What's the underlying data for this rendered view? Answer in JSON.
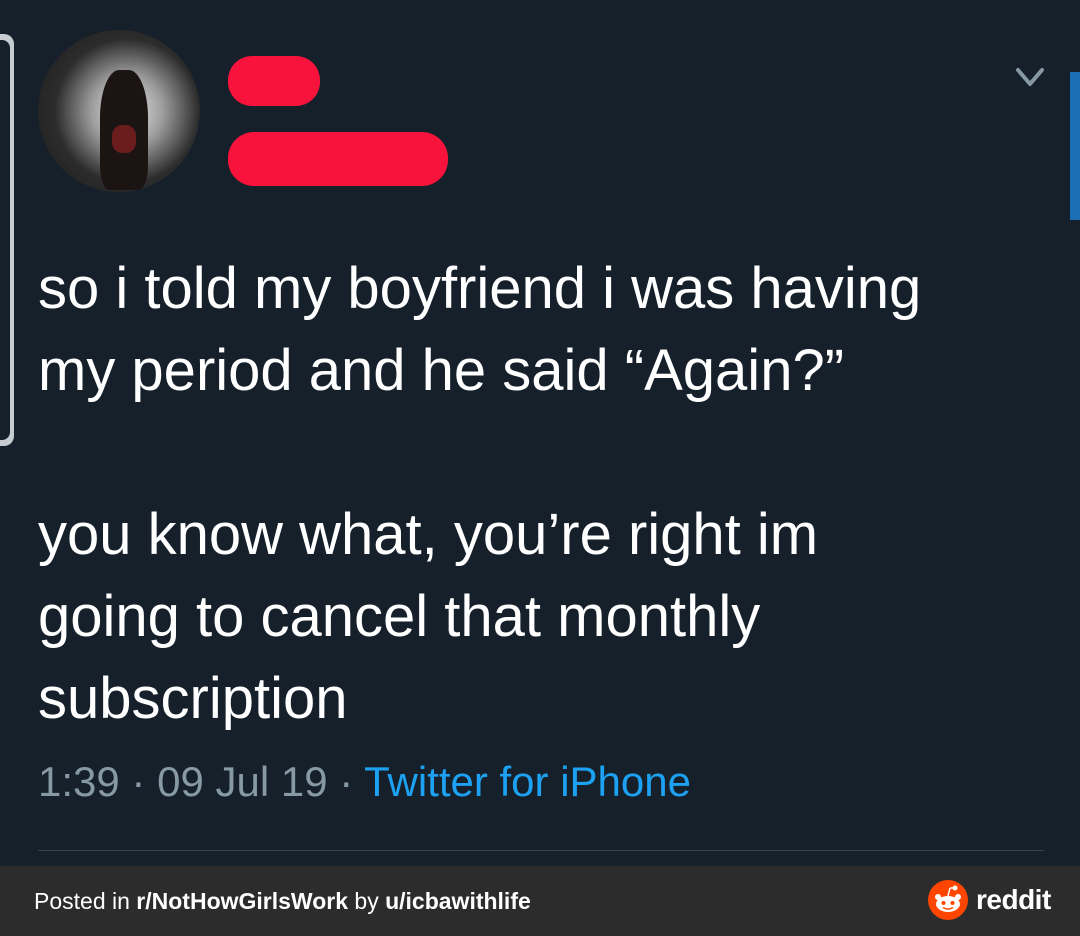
{
  "tweet": {
    "text": "so i told my boyfriend i was having\nmy period and he said “Again?”\n\nyou know what, you’re right im\ngoing to cancel that monthly\nsubscription",
    "time": "1:39",
    "date": "09 Jul 19",
    "source": "Twitter for iPhone",
    "separator": "·"
  },
  "footer": {
    "posted_in_label": "Posted in ",
    "subreddit": "r/NotHowGirlsWork",
    "by_label": " by ",
    "username": "u/icbawithlife",
    "reddit_wordmark": "reddit"
  },
  "colors": {
    "background": "#15202b",
    "redaction": "#f7133c",
    "link": "#1da1f2",
    "muted": "#8899a6",
    "footer_bg": "#2c2c2c",
    "reddit_orange": "#ff4500"
  },
  "icons": {
    "more_options": "chevron-down-icon",
    "reddit_logo": "reddit-snoo-icon"
  }
}
